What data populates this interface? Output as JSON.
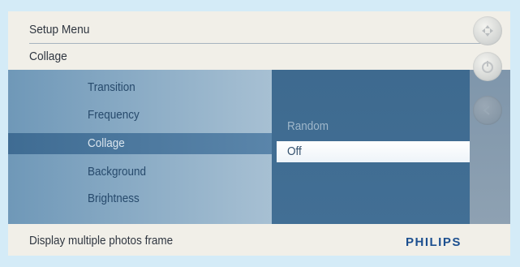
{
  "header": {
    "title": "Setup Menu",
    "subtitle": "Collage"
  },
  "menu": {
    "items": [
      {
        "label": "Transition",
        "selected": false
      },
      {
        "label": "Frequency",
        "selected": false
      },
      {
        "label": "Collage",
        "selected": true
      },
      {
        "label": "Background",
        "selected": false
      },
      {
        "label": "Brightness",
        "selected": false
      }
    ]
  },
  "options": {
    "items": [
      {
        "label": "Random",
        "selected": false
      },
      {
        "label": "Off",
        "selected": true
      }
    ]
  },
  "footer": {
    "description": "Display multiple photos frame",
    "brand": "PHILIPS"
  },
  "side_icons": [
    "navigation-icon",
    "power-icon",
    "back-icon"
  ],
  "colors": {
    "brand": "#1c4f8f",
    "highlight": "#3f6c93",
    "panel": "#426f95"
  }
}
